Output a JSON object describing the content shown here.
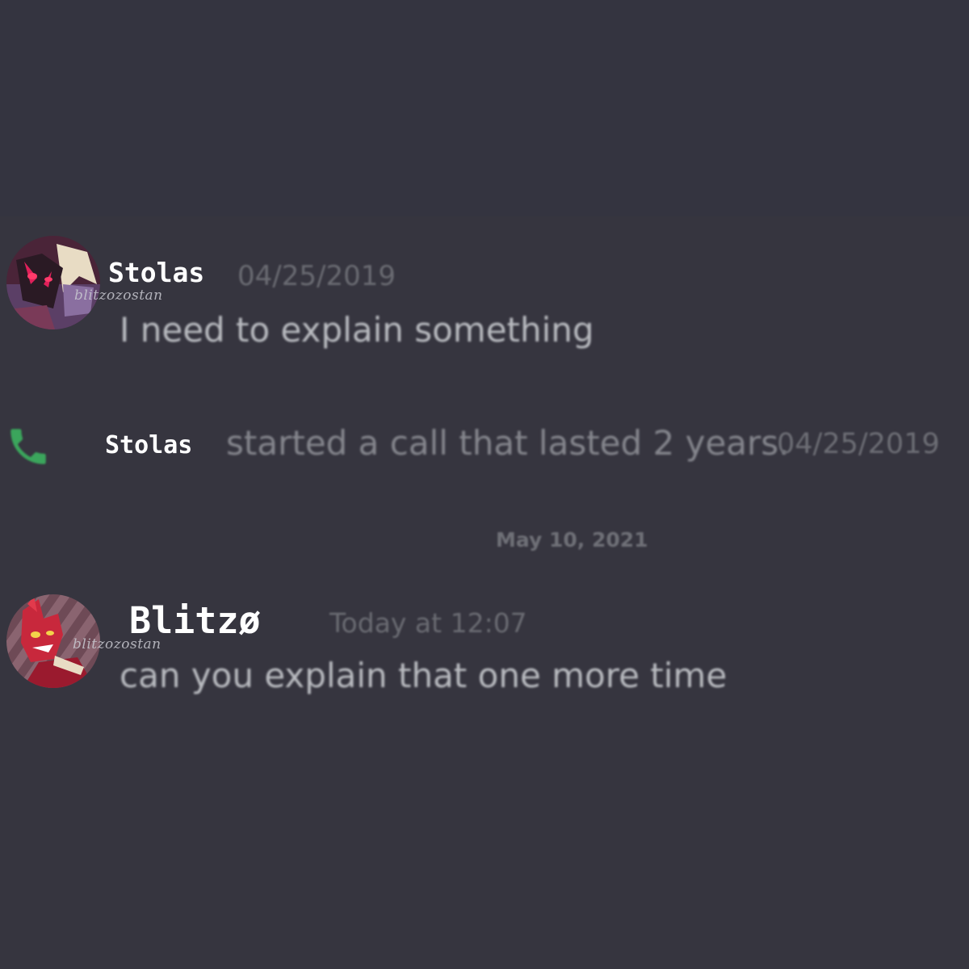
{
  "messages": [
    {
      "username": "Stolas",
      "timestamp": "04/25/2019",
      "watermark": "blitzozostan",
      "text": "I need to explain something"
    },
    {
      "username": "Blitzø",
      "timestamp": "Today at 12:07",
      "watermark": "blitzozostan",
      "text": "can you explain that one more time"
    }
  ],
  "call": {
    "icon": "phone-icon",
    "username": "Stolas",
    "text": "started a call that lasted 2 years.",
    "timestamp": "04/25/2019"
  },
  "date_divider": "May 10, 2021",
  "colors": {
    "background": "#36353f",
    "username": "#ffffff",
    "message_text": "#b9bbc0",
    "timestamp": "#6a6b72",
    "call_icon": "#3ba55c"
  }
}
